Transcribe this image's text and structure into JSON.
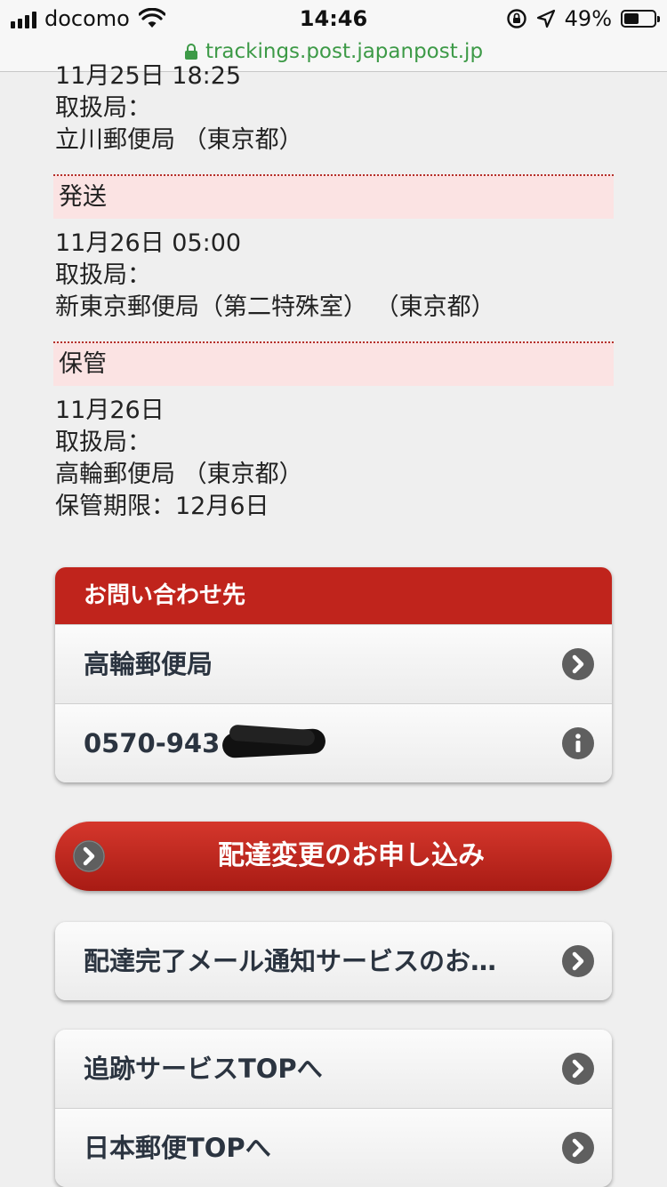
{
  "status_bar": {
    "carrier": "docomo",
    "time": "14:46",
    "battery_percent": "49%",
    "battery_level": 0.49
  },
  "url_bar": {
    "url": "trackings.post.japanpost.jp"
  },
  "history": {
    "top_entry": {
      "datetime": "11月25日 18:25",
      "office_label": "取扱局：",
      "office": "立川郵便局 （東京都）"
    },
    "entries": [
      {
        "status": "発送",
        "datetime": "11月26日 05:00",
        "office_label": "取扱局：",
        "office": "新東京郵便局（第二特殊室） （東京都）"
      },
      {
        "status": "保管",
        "datetime": "11月26日",
        "office_label": "取扱局：",
        "office": "高輪郵便局 （東京都）",
        "storage_deadline": "保管期限：12月6日"
      }
    ]
  },
  "contact": {
    "header": "お問い合わせ先",
    "office_name": "高輪郵便局",
    "phone": "0570-943"
  },
  "actions": {
    "change_delivery": "配達変更のお申し込み",
    "mail_notification": "配達完了メール通知サービスのお…",
    "tracking_top": "追跡サービスTOPへ",
    "japanpost_top": "日本郵便TOPへ"
  },
  "icons": {
    "signal": "cellular-signal-icon",
    "wifi": "wifi-icon",
    "rotation_lock": "rotation-lock-icon",
    "location": "location-arrow-icon",
    "battery": "battery-icon",
    "lock": "lock-icon",
    "chevron": "chevron-right-circle-icon",
    "info": "info-circle-icon"
  },
  "colors": {
    "brand_red": "#c0241c",
    "status_background": "#fbe3e3",
    "url_green": "#3d9a47",
    "icon_gray": "#5f5f5f"
  }
}
